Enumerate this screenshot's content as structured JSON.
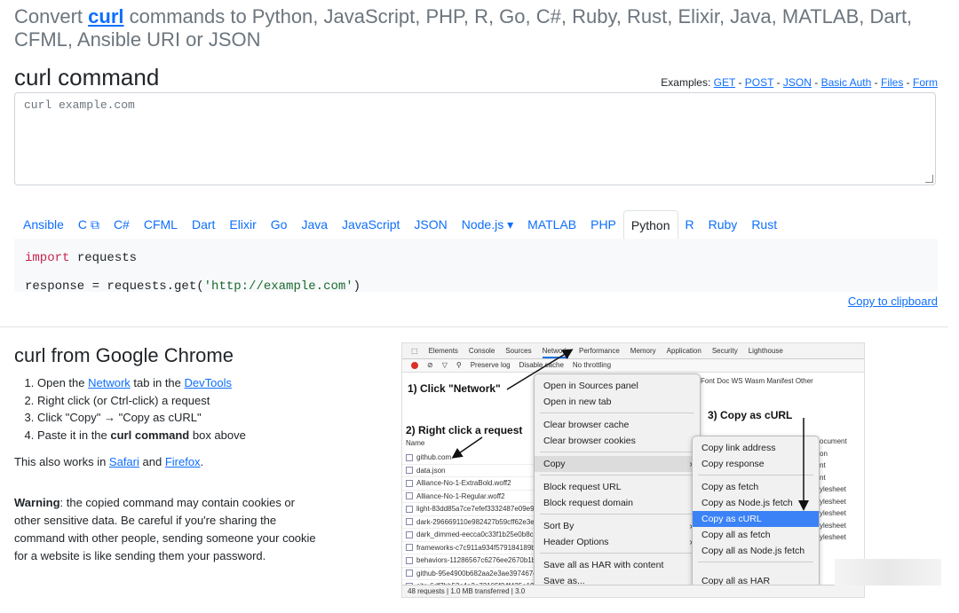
{
  "header": {
    "title_prefix": "Convert ",
    "title_link": "curl",
    "title_suffix": " commands to Python, JavaScript, PHP, R, Go, C#, Ruby, Rust, Elixir, Java, MATLAB, Dart, CFML, Ansible URI or JSON"
  },
  "curl_section": {
    "heading": "curl command",
    "examples_label": "Examples:",
    "examples": [
      "GET",
      "POST",
      "JSON",
      "Basic Auth",
      "Files",
      "Form"
    ],
    "input_placeholder": "curl example.com"
  },
  "language_tabs": [
    "Ansible",
    "C",
    "C#",
    "CFML",
    "Dart",
    "Elixir",
    "Go",
    "Java",
    "JavaScript",
    "JSON",
    "Node.js",
    "MATLAB",
    "PHP",
    "Python",
    "R",
    "Ruby",
    "Rust"
  ],
  "active_tab": "Python",
  "external_icon": "external-link-icon",
  "dropdown_icon": "caret-down-icon",
  "code": {
    "line1_kw": "import",
    "line1_rest": " requests",
    "line2_pre": "response = requests.get(",
    "line2_str": "'http://example.com'",
    "line2_post": ")"
  },
  "copy_label": "Copy to clipboard",
  "chrome": {
    "heading": "curl from Google Chrome",
    "step1_pre": "Open the ",
    "step1_link1": "Network",
    "step1_mid": " tab in the ",
    "step1_link2": "DevTools",
    "step2": "Right click (or Ctrl-click) a request",
    "step3": "Click \"Copy\" → \"Copy as cURL\"",
    "step4_pre": "Paste it in the ",
    "step4_bold": "curl command",
    "step4_post": " box above",
    "also_pre": "This also works in ",
    "also_link1": "Safari",
    "also_and": " and ",
    "also_link2": "Firefox",
    "also_post": ".",
    "warning_bold": "Warning",
    "warning_text": ": the copied command may contain cookies or other sensitive data. Be careful if you're sharing the command with other people, sending someone your cookie for a website is like sending them your password."
  },
  "devtools": {
    "tabs": [
      "Elements",
      "Console",
      "Sources",
      "Network",
      "Performance",
      "Memory",
      "Application",
      "Security",
      "Lighthouse"
    ],
    "toolbar": [
      "Preserve log",
      "Disable cache",
      "No throttling"
    ],
    "filters": "Font  Doc  WS  Wasm  Manifest  Other",
    "annotation1": "1) Click \"Network\"",
    "annotation2": "2) Right click a request",
    "annotation3": "3) Copy as cURL",
    "column_name": "Name",
    "requests": [
      "github.com",
      "data.json",
      "Alliance-No-1-ExtraBold.woff2",
      "Alliance-No-1-Regular.woff2",
      "light-83dd85a7ce7efef3332487e09e9",
      "dark-296669110e982427b59cff62e3e",
      "dark_dimmed-eecca0c33f1b25e0b8c",
      "frameworks-c7c911a934f579184189b",
      "behaviors-11286567c6276ee2670b1b",
      "github-95e4900b682aa2e3ae397467c",
      "site-6df7bb53c4a3e73105f24f435e19"
    ],
    "types": [
      "ocument",
      "on",
      "nt",
      "nt",
      "ylesheet",
      "ylesheet",
      "ylesheet",
      "ylesheet",
      "ylesheet"
    ],
    "menu": [
      "Open in Sources panel",
      "Open in new tab",
      "Clear browser cache",
      "Clear browser cookies",
      "Copy",
      "Block request URL",
      "Block request domain",
      "Sort By",
      "Header Options",
      "Save all as HAR with content",
      "Save as..."
    ],
    "submenu": [
      "Copy link address",
      "Copy response",
      "Copy as fetch",
      "Copy as Node.js fetch",
      "Copy as cURL",
      "Copy all as fetch",
      "Copy all as Node.js fetch",
      "Copy all as HAR"
    ],
    "status": "48 requests  |  1.0 MB transferred  |  3.0"
  }
}
